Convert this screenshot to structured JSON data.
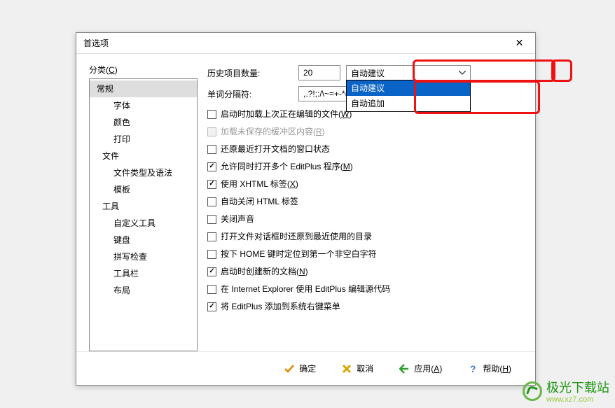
{
  "title": "首选项",
  "category_label": "分类",
  "category_accel": "C",
  "tree": [
    {
      "label": "常规",
      "sel": true,
      "indent": 0
    },
    {
      "label": "字体",
      "indent": 1
    },
    {
      "label": "颜色",
      "indent": 1
    },
    {
      "label": "打印",
      "indent": 1
    },
    {
      "label": "文件",
      "indent": 0
    },
    {
      "label": "文件类型及语法",
      "indent": 1
    },
    {
      "label": "模板",
      "indent": 1
    },
    {
      "label": "工具",
      "indent": 0
    },
    {
      "label": "自定义工具",
      "indent": 1
    },
    {
      "label": "键盘",
      "indent": 1
    },
    {
      "label": "拼写检查",
      "indent": 1
    },
    {
      "label": "工具栏",
      "indent": 1
    },
    {
      "label": "布局",
      "indent": 1
    }
  ],
  "row1": {
    "label": "历史项目数量:",
    "value": "20"
  },
  "combo": {
    "selected": "自动建议",
    "options": [
      "自动建议",
      "自动追加"
    ],
    "highlight": 0
  },
  "row2": {
    "label": "单词分隔符:",
    "value": ",.?!;:/\\~=+-*("
  },
  "checks": [
    {
      "label": "启动时加载上次正在编辑的文件(",
      "accel": "W",
      "tail": ")",
      "checked": false,
      "disabled": false
    },
    {
      "label": "加载未保存的缓冲区内容(",
      "accel": "R",
      "tail": ")",
      "checked": false,
      "disabled": true
    },
    {
      "label": "还原最近打开文档的窗口状态",
      "checked": false
    },
    {
      "label": "允许同时打开多个 EditPlus 程序(",
      "accel": "M",
      "tail": ")",
      "checked": true
    },
    {
      "label": "使用 XHTML 标签(",
      "accel": "X",
      "tail": ")",
      "checked": true
    },
    {
      "label": "自动关闭 HTML 标签",
      "checked": false
    },
    {
      "label": "关闭声音",
      "checked": false
    },
    {
      "label": "打开文件对话框时还原到最近使用的目录",
      "checked": false
    },
    {
      "label": "按下 HOME 键时定位到第一个非空白字符",
      "checked": false
    },
    {
      "label": "启动时创建新的文档(",
      "accel": "N",
      "tail": ")",
      "checked": true
    },
    {
      "label": "在 Internet Explorer 使用 EditPlus 编辑源代码",
      "checked": false
    },
    {
      "label": "将 EditPlus 添加到系统右键菜单",
      "checked": true
    }
  ],
  "buttons": {
    "ok": "确定",
    "cancel": "取消",
    "apply": "应用",
    "apply_accel": "A",
    "help": "帮助",
    "help_accel": "H"
  },
  "watermark": {
    "main": "极光下载站",
    "sub": "www.xz7.com"
  }
}
